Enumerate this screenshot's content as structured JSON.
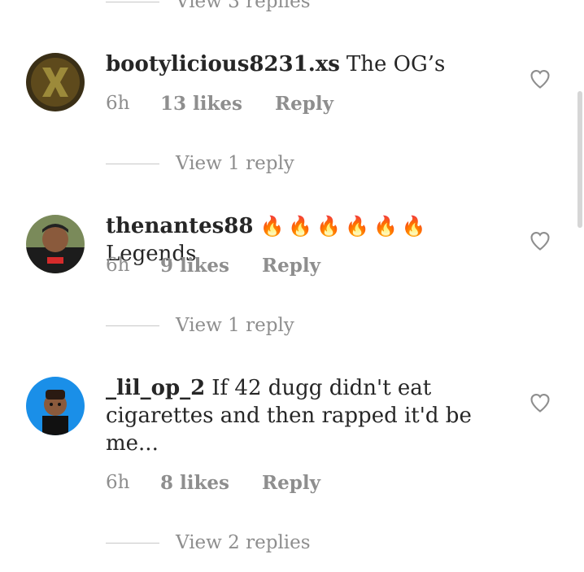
{
  "top_view_replies": {
    "label": "View 3 replies"
  },
  "comments": [
    {
      "username": "bootylicious8231.xs",
      "text": "The OG’s",
      "emoji": "",
      "time": "6h",
      "likes": "13 likes",
      "reply_label": "Reply",
      "view_replies": "View 1 reply"
    },
    {
      "username": "thenantes88",
      "text": "Legends",
      "emoji": "🔥🔥🔥🔥🔥🔥",
      "time": "6h",
      "likes": "9 likes",
      "reply_label": "Reply",
      "view_replies": "View 1 reply"
    },
    {
      "username": "_lil_op_2",
      "text": "If 42 dugg didn't eat cigarettes and then rapped it'd be me...",
      "emoji": "",
      "time": "6h",
      "likes": "8 likes",
      "reply_label": "Reply",
      "view_replies": "View 2 replies"
    }
  ],
  "icons": {
    "like": "heart-outline-icon",
    "emoji": "fire-emoji"
  },
  "colors": {
    "text": "#262626",
    "secondary": "#8e8e8e",
    "divider": "#c7c7c7"
  }
}
